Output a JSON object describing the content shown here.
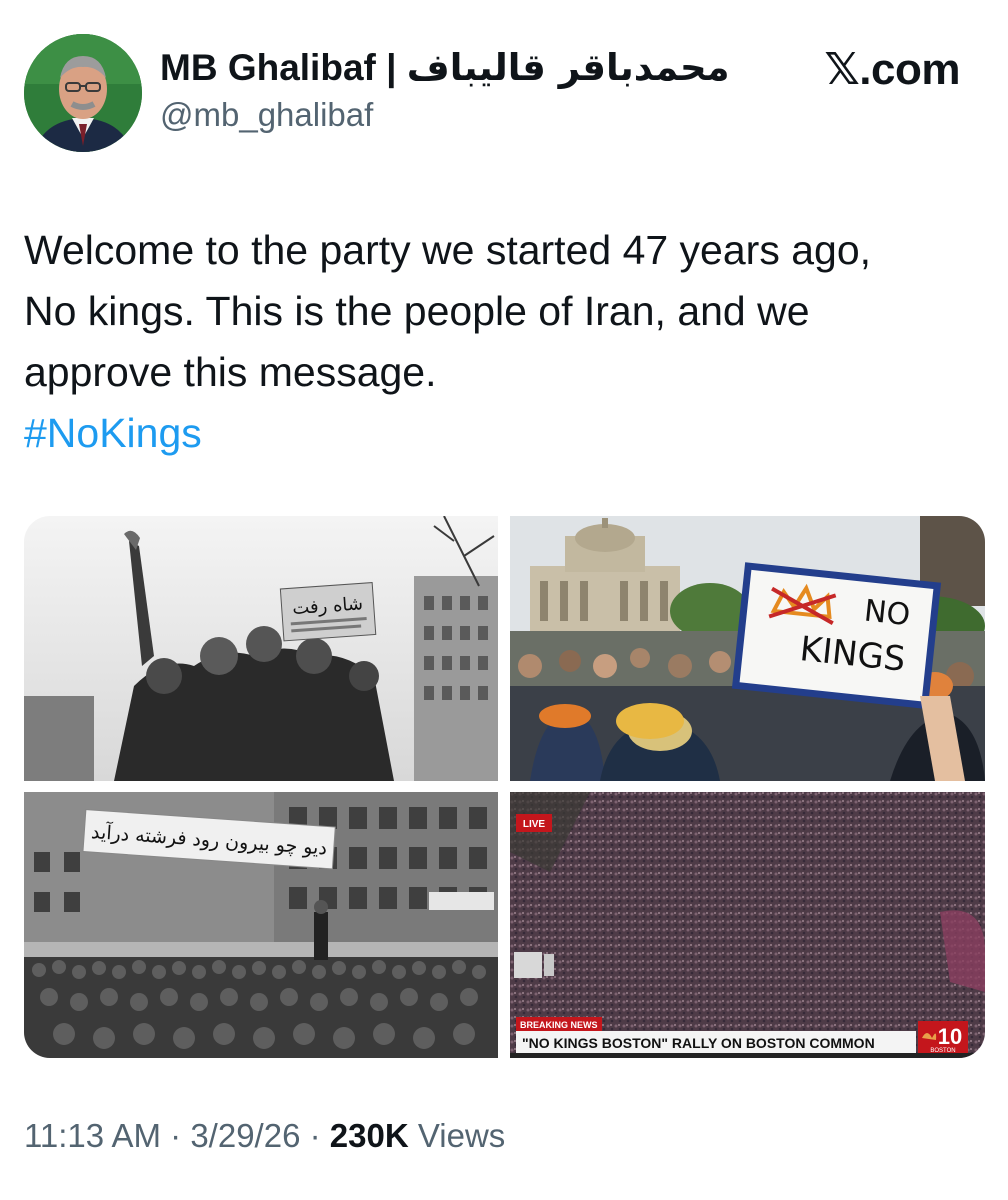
{
  "author": {
    "name": "MB Ghalibaf",
    "separator": "|",
    "name_persian": "محمدباقر قالیباف",
    "handle": "@mb_ghalibaf"
  },
  "brand": "𝕏.com",
  "tweet": {
    "lines": [
      "Welcome to the party we started 47 years ago,",
      "No kings. This is the people of Iran, and we",
      "approve this message."
    ],
    "hashtag": "#NoKings"
  },
  "media": {
    "photo1": {
      "sign_text": "شاه رفت"
    },
    "photo2": {
      "sign_line1": "NO",
      "sign_line2": "KINGS"
    },
    "photo3": {
      "banner_text": "دیو چو بیرون رود فرشته درآید"
    },
    "photo4": {
      "live_label": "LIVE",
      "breaking_label": "BREAKING NEWS",
      "headline": "\"NO KINGS BOSTON\" RALLY ON BOSTON COMMON",
      "channel_number": "10",
      "channel_city": "BOSTON"
    }
  },
  "timestamp": {
    "time": "11:13 AM",
    "date": "3/29/26",
    "separator": "·",
    "views_count": "230K",
    "views_label": "Views"
  },
  "colors": {
    "accent": "#1d9bf0",
    "secondary_text": "#536471",
    "primary_text": "#0f1419",
    "news_red": "#c4161c"
  }
}
